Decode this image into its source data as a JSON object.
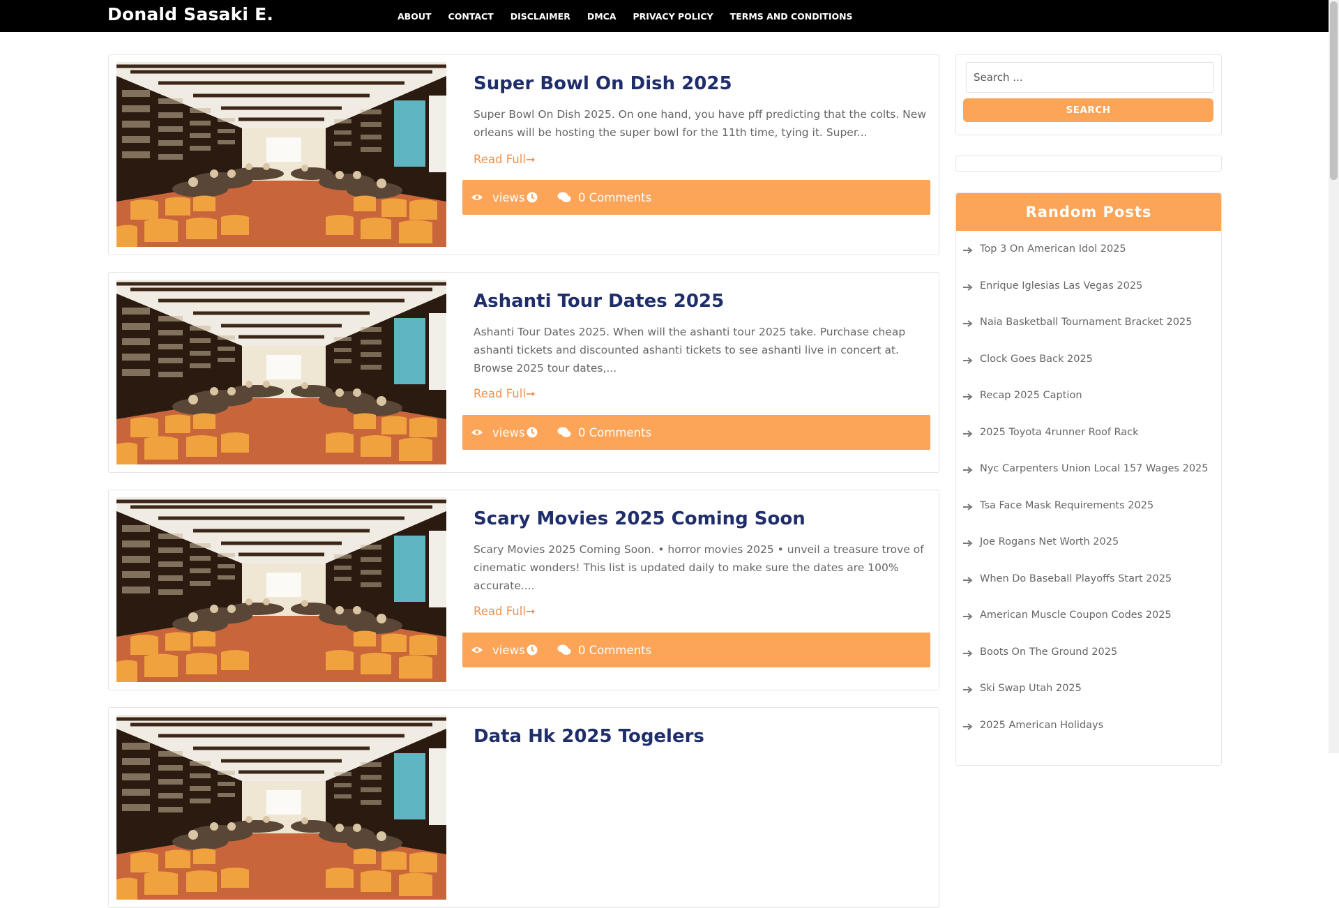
{
  "header": {
    "site_title": "Donald Sasaki E.",
    "nav": [
      "ABOUT",
      "CONTACT",
      "DISCLAIMER",
      "DMCA",
      "PRIVACY POLICY",
      "TERMS AND CONDITIONS"
    ]
  },
  "posts": [
    {
      "title": "Super Bowl On Dish 2025",
      "excerpt": "Super Bowl On Dish 2025. On one hand, you have pff predicting that the colts. New orleans will be hosting the super bowl for the 11th time, tying it. Super...",
      "read_more": "Read Full",
      "views_label": "views",
      "comments": "0 Comments"
    },
    {
      "title": "Ashanti Tour Dates 2025",
      "excerpt": "Ashanti Tour Dates 2025. When will the ashanti tour 2025 take. Purchase cheap ashanti tickets and discounted ashanti tickets to see ashanti live in concert at. Browse 2025 tour dates,...",
      "read_more": "Read Full",
      "views_label": "views",
      "comments": "0 Comments"
    },
    {
      "title": "Scary Movies 2025 Coming Soon",
      "excerpt": "Scary Movies 2025 Coming Soon. • horror movies 2025 • unveil a treasure trove of cinematic wonders! This list is updated daily to make sure the dates are 100% accurate....",
      "read_more": "Read Full",
      "views_label": "views",
      "comments": "0 Comments"
    },
    {
      "title": "Data Hk 2025 Togelers"
    }
  ],
  "sidebar": {
    "search": {
      "placeholder": "Search ...",
      "button": "SEARCH"
    },
    "random_posts": {
      "title": "Random Posts",
      "items": [
        "Top 3 On American Idol 2025",
        "Enrique Iglesias Las Vegas 2025",
        "Naia Basketball Tournament Bracket 2025",
        "Clock Goes Back 2025",
        "Recap 2025 Caption",
        "2025 Toyota 4runner Roof Rack",
        "Nyc Carpenters Union Local 157 Wages 2025",
        "Tsa Face Mask Requirements 2025",
        "Joe Rogans Net Worth 2025",
        "When Do Baseball Playoffs Start 2025",
        "American Muscle Coupon Codes 2025",
        "Boots On The Ground 2025",
        "Ski Swap Utah 2025",
        "2025 American Holidays"
      ]
    }
  },
  "icons": {
    "views": "eye-icon",
    "time": "clock-icon",
    "comments": "comments-icon",
    "read_more": "long-arrow-right-icon",
    "list": "long-arrow-right-icon"
  },
  "colors": {
    "accent": "#fca458",
    "title": "#1f2e6b",
    "header_bg": "#000000"
  }
}
